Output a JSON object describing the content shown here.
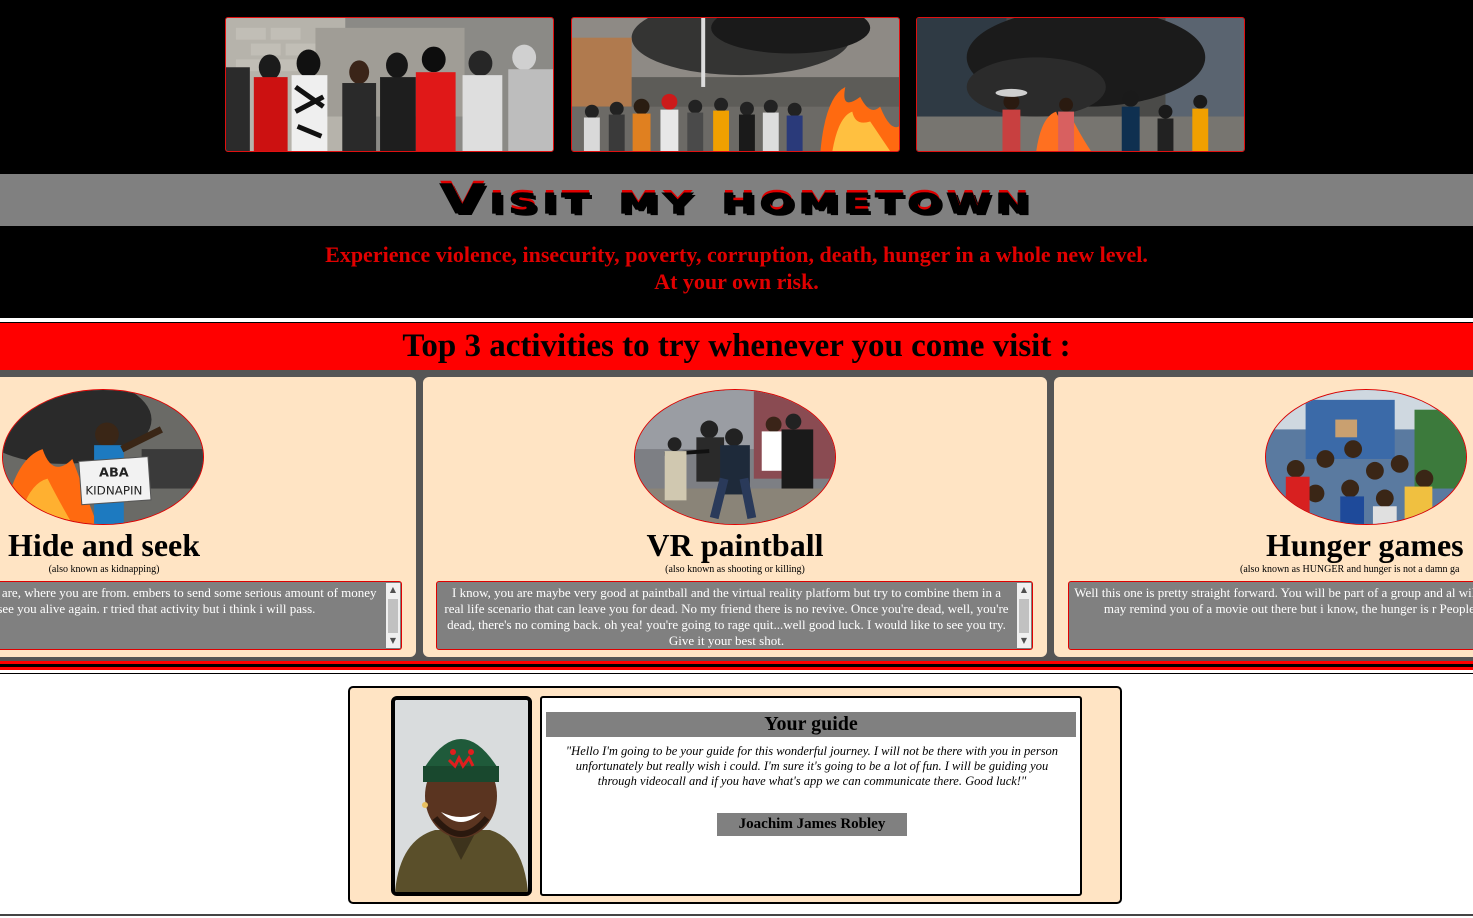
{
  "header": {
    "photos": [
      {
        "icon": "gang-crowd-photo"
      },
      {
        "icon": "street-fire-crowd-photo"
      },
      {
        "icon": "burning-street-photo"
      }
    ],
    "title": "Visit my hometown",
    "tagline_line1": "Experience violence, insecurity, poverty, corruption, death, hunger in a whole new level.",
    "tagline_line2": "At your own risk."
  },
  "activities": {
    "heading": "Top 3 activities to try whenever you come visit :",
    "cards": [
      {
        "title": "Hide and seek",
        "aka": "(also known as kidnapping)",
        "sign_text_1": "ABA",
        "sign_text_2": "KIDNAPIN",
        "description": "you, regardless of who you are, where you are from. embers to send some serious amount of money if they want to see you alive again. r tried that activity but i think i will pass."
      },
      {
        "title": "VR paintball",
        "aka": "(also known as shooting or killing)",
        "description": "I know, you are maybe very good at paintball and the virtual reality platform but try to combine them in a real life scenario that can leave you for dead. No my friend there is no revive. Once you're dead, well, you're dead, there's no coming back. oh yea! you're going to rage quit...well good luck. I would like to see you try. Give it your best shot."
      },
      {
        "title": "Hunger games",
        "aka": "(also known as HUNGER and hunger is not a damn ga",
        "description": "Well this one is pretty straight forward. You will be part of a group and al wild to fend for yourself. I know, it may remind you of a movie out there but i know, the hunger is r People will actually kill for food."
      }
    ]
  },
  "guide": {
    "heading": "Your guide",
    "quote": "\"Hello I'm going to be your guide for this wonderful journey. I will not be there with you in person unfortunately but really wish i could. I'm sure it's going to be a lot of fun. I will be guiding you through videocall and if you have what's app we can communicate there. Good luck!\"",
    "name": "Joachim James Robley",
    "photo_icon": "guide-portrait"
  },
  "colors": {
    "accent_red": "#ff0000",
    "text_red": "#e00000",
    "card_bg": "#ffe4c4",
    "gray": "#808080",
    "dark": "#000000"
  }
}
